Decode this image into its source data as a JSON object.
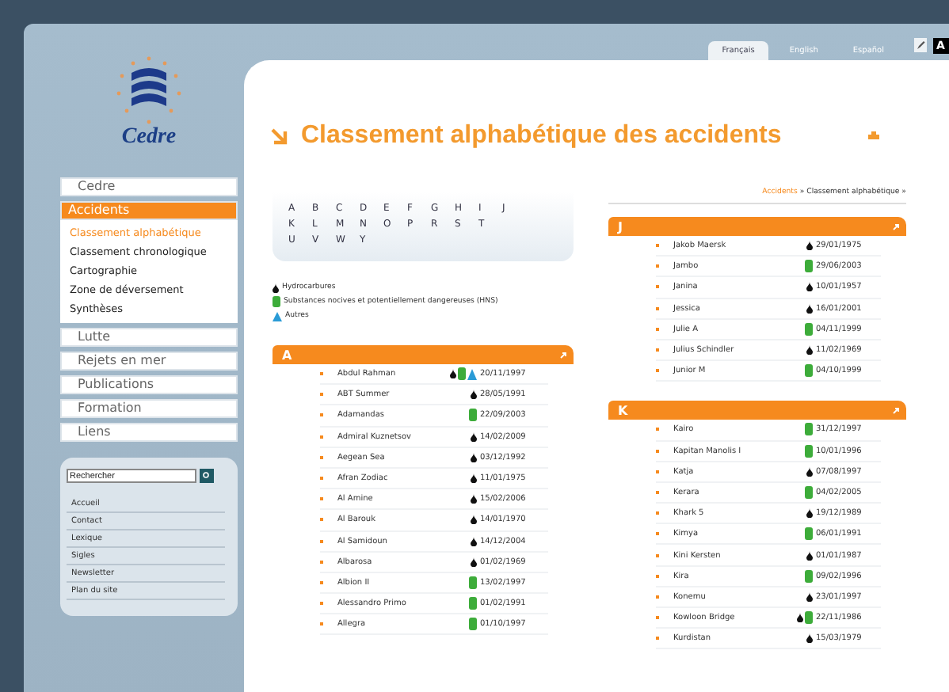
{
  "languages": [
    {
      "label": "Français",
      "selected": true
    },
    {
      "label": "English",
      "selected": false
    },
    {
      "label": "Español",
      "selected": false
    }
  ],
  "corner_badge": "A",
  "logo_text": "Cedre",
  "menu": [
    {
      "label": "Cedre",
      "selected": false
    },
    {
      "label": "Accidents",
      "selected": true,
      "children": [
        {
          "label": "Classement alphabétique",
          "selected": true
        },
        {
          "label": "Classement chronologique",
          "selected": false
        },
        {
          "label": "Cartographie",
          "selected": false
        },
        {
          "label": "Zone de déversement",
          "selected": false
        },
        {
          "label": "Synthèses",
          "selected": false
        }
      ]
    },
    {
      "label": "Lutte",
      "selected": false
    },
    {
      "label": "Rejets en mer",
      "selected": false
    },
    {
      "label": "Publications",
      "selected": false
    },
    {
      "label": "Formation",
      "selected": false
    },
    {
      "label": "Liens",
      "selected": false
    }
  ],
  "search": {
    "placeholder": "Rechercher"
  },
  "footer_links": [
    "Accueil",
    "Contact",
    "Lexique",
    "Sigles",
    "Newsletter",
    "Plan du site"
  ],
  "title": "Classement alphabétique des accidents",
  "breadcrumb": {
    "link": "Accidents",
    "current": "» Classement alphabétique »"
  },
  "alphabet": [
    [
      "A",
      "B",
      "C",
      "D",
      "E",
      "F",
      "G",
      "H",
      "I",
      "J"
    ],
    [
      "K",
      "L",
      "M",
      "N",
      "O",
      "P",
      "R",
      "S",
      "T"
    ],
    [
      "U",
      "V",
      "W",
      "Y"
    ]
  ],
  "legend": [
    {
      "kind": "hydrocarbon",
      "label": "Hydrocarbures"
    },
    {
      "kind": "hns",
      "label": "Substances nocives et potentiellement dangereuses (HNS)"
    },
    {
      "kind": "other",
      "label": "Autres"
    }
  ],
  "left_sections": [
    {
      "letter": "A",
      "items": [
        {
          "name": "Abdul Rahman",
          "substances": [
            {
              "kind": "hydrocarbon"
            },
            {
              "kind": "hns"
            },
            {
              "kind": "other"
            }
          ],
          "date": "20/11/1997"
        },
        {
          "name": "ABT Summer",
          "substances": [
            {
              "kind": "hydrocarbon"
            }
          ],
          "date": "28/05/1991"
        },
        {
          "name": "Adamandas",
          "substances": [
            {
              "kind": "hns"
            }
          ],
          "date": "22/09/2003"
        },
        {
          "name": "Admiral Kuznetsov",
          "substances": [
            {
              "kind": "hydrocarbon"
            }
          ],
          "date": "14/02/2009"
        },
        {
          "name": "Aegean Sea",
          "substances": [
            {
              "kind": "hydrocarbon"
            }
          ],
          "date": "03/12/1992"
        },
        {
          "name": "Afran Zodiac",
          "substances": [
            {
              "kind": "hydrocarbon"
            }
          ],
          "date": "11/01/1975"
        },
        {
          "name": "Al Amine",
          "substances": [
            {
              "kind": "hydrocarbon"
            }
          ],
          "date": "15/02/2006"
        },
        {
          "name": "Al Barouk",
          "substances": [
            {
              "kind": "hydrocarbon"
            }
          ],
          "date": "14/01/1970"
        },
        {
          "name": "Al Samidoun",
          "substances": [
            {
              "kind": "hydrocarbon"
            }
          ],
          "date": "14/12/2004"
        },
        {
          "name": "Albarosa",
          "substances": [
            {
              "kind": "hydrocarbon"
            }
          ],
          "date": "01/02/1969"
        },
        {
          "name": "Albion II",
          "substances": [
            {
              "kind": "hns"
            }
          ],
          "date": "13/02/1997"
        },
        {
          "name": "Alessandro Primo",
          "substances": [
            {
              "kind": "hns"
            }
          ],
          "date": "01/02/1991"
        },
        {
          "name": "Allegra",
          "substances": [
            {
              "kind": "hns"
            }
          ],
          "date": "01/10/1997"
        }
      ]
    }
  ],
  "right_sections": [
    {
      "letter": "J",
      "items": [
        {
          "name": "Jakob Maersk",
          "substances": [
            {
              "kind": "hydrocarbon"
            }
          ],
          "date": "29/01/1975"
        },
        {
          "name": "Jambo",
          "substances": [
            {
              "kind": "hns"
            }
          ],
          "date": "29/06/2003"
        },
        {
          "name": "Janina",
          "substances": [
            {
              "kind": "hydrocarbon"
            }
          ],
          "date": "10/01/1957"
        },
        {
          "name": "Jessica",
          "substances": [
            {
              "kind": "hydrocarbon"
            }
          ],
          "date": "16/01/2001"
        },
        {
          "name": "Julie A",
          "substances": [
            {
              "kind": "hns"
            }
          ],
          "date": "04/11/1999"
        },
        {
          "name": "Julius Schindler",
          "substances": [
            {
              "kind": "hydrocarbon"
            }
          ],
          "date": "11/02/1969"
        },
        {
          "name": "Junior M",
          "substances": [
            {
              "kind": "hns"
            }
          ],
          "date": "04/10/1999"
        }
      ]
    },
    {
      "letter": "K",
      "items": [
        {
          "name": "Kairo",
          "substances": [
            {
              "kind": "hns"
            }
          ],
          "date": "31/12/1997"
        },
        {
          "name": "Kapitan Manolis I",
          "substances": [
            {
              "kind": "hns"
            }
          ],
          "date": "10/01/1996"
        },
        {
          "name": "Katja",
          "substances": [
            {
              "kind": "hydrocarbon"
            }
          ],
          "date": "07/08/1997"
        },
        {
          "name": "Kerara",
          "substances": [
            {
              "kind": "hns"
            }
          ],
          "date": "04/02/2005"
        },
        {
          "name": "Khark 5",
          "substances": [
            {
              "kind": "hydrocarbon"
            }
          ],
          "date": "19/12/1989"
        },
        {
          "name": "Kimya",
          "substances": [
            {
              "kind": "hns"
            }
          ],
          "date": "06/01/1991"
        },
        {
          "name": "Kini Kersten",
          "substances": [
            {
              "kind": "hydrocarbon"
            }
          ],
          "date": "01/01/1987"
        },
        {
          "name": "Kira",
          "substances": [
            {
              "kind": "hns"
            }
          ],
          "date": "09/02/1996"
        },
        {
          "name": "Konemu",
          "substances": [
            {
              "kind": "hydrocarbon"
            }
          ],
          "date": "23/01/1997"
        },
        {
          "name": "Kowloon Bridge",
          "substances": [
            {
              "kind": "hydrocarbon"
            },
            {
              "kind": "hns"
            }
          ],
          "date": "22/11/1986"
        },
        {
          "name": "Kurdistan",
          "substances": [
            {
              "kind": "hydrocarbon"
            }
          ],
          "date": "15/03/1979"
        }
      ]
    }
  ]
}
